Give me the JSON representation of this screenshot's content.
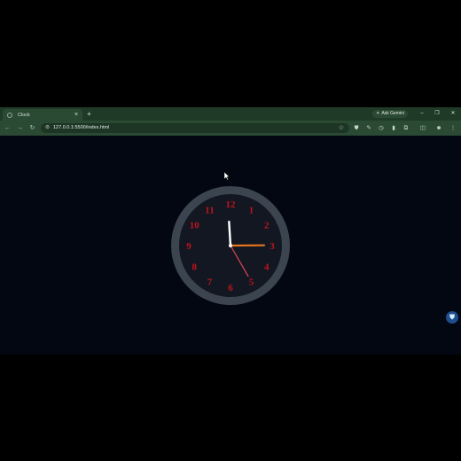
{
  "browser": {
    "tab": {
      "title": "Clock",
      "close_glyph": "×",
      "favicon": "globe-icon"
    },
    "new_tab_glyph": "+",
    "ask_gemini_label": "Ask Gemini",
    "window_controls": {
      "minimize": "–",
      "restore": "❐",
      "close": "✕"
    },
    "nav": {
      "back": "←",
      "forward": "→",
      "reload": "↻"
    },
    "address_bar": {
      "url": "127.0.0.1:5500/index.html"
    },
    "colors": {
      "tabstrip": "#1f3a26",
      "toolbar": "#2b4a33",
      "page_background": "#030712"
    }
  },
  "clock": {
    "numerals": [
      "12",
      "1",
      "2",
      "3",
      "4",
      "5",
      "6",
      "7",
      "8",
      "9",
      "10",
      "11"
    ],
    "time": {
      "hours": 2,
      "minutes": 59,
      "seconds": 25
    },
    "colors": {
      "rim": "#3c4450",
      "face": "#121722",
      "numerals": "#c0141c",
      "hour_hand": "#e8741c",
      "minute_hand": "#ffffff",
      "second_hand": "#e0455a"
    }
  }
}
